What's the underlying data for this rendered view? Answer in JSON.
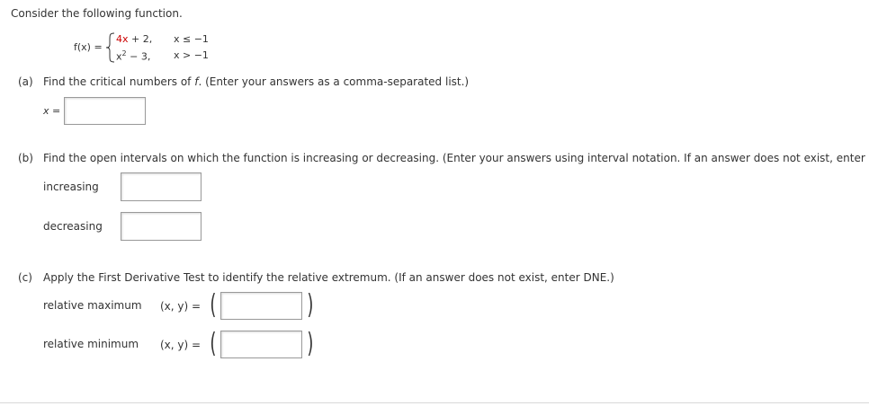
{
  "intro": "Consider the following function.",
  "function": {
    "lhs": "f(x) =",
    "piece1_expr_prefix": "4x",
    "piece1_expr_suffix": "+ 2,",
    "piece1_cond": "x ≤ −1",
    "piece2_expr_base": "x",
    "piece2_expr_exp": "2",
    "piece2_expr_rest": "− 3,",
    "piece2_cond": "x > −1"
  },
  "part_a": {
    "label": "(a)",
    "question_pre": "Find the critical numbers of ",
    "question_var": "f",
    "question_post": ". (Enter your answers as a comma-separated list.)",
    "answer_label": "x =",
    "answer_value": ""
  },
  "part_b": {
    "label": "(b)",
    "question": "Find the open intervals on which the function is increasing or decreasing. (Enter your answers using interval notation. If an answer does not exist, enter DN",
    "increasing_label": "increasing",
    "increasing_value": "",
    "decreasing_label": "decreasing",
    "decreasing_value": ""
  },
  "part_c": {
    "label": "(c)",
    "question": "Apply the First Derivative Test to identify the relative extremum. (If an answer does not exist, enter DNE.)",
    "max_label": "relative maximum",
    "max_xy": "(x, y) =",
    "max_value": "",
    "min_label": "relative minimum",
    "min_xy": "(x, y) =",
    "min_value": ""
  },
  "colors": {
    "text": "#333333",
    "highlight_red": "#cc0000",
    "input_border": "#9a9a9a"
  }
}
